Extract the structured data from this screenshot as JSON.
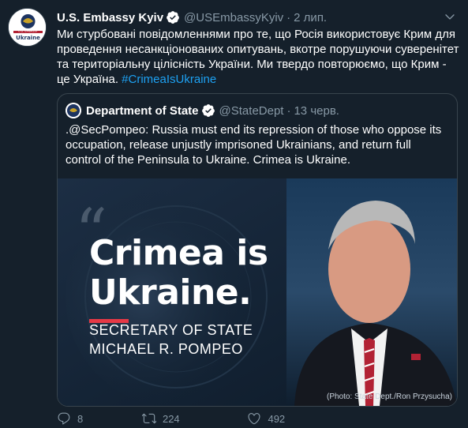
{
  "tweet": {
    "display_name": "U.S. Embassy Kyiv",
    "handle": "@USEmbassyKyiv",
    "separator": "·",
    "date": "2 лип.",
    "avatar_label_top": "U.S. EMBASSY",
    "avatar_label_bottom": "Ukraine",
    "text": "Ми стурбовані повідомленнями про те, що Росія використовує Крим для проведення несанкціонованих опитувань, вкотре порушуючи суверенітет та територіальну цілісність України. Ми твердо повторюємо, що Крим - це Україна. ",
    "hashtag": "#CrimeaIsUkraine"
  },
  "quoted": {
    "display_name": "Department of State",
    "handle": "@StateDept",
    "separator": "·",
    "date": "13 черв.",
    "text": ".@SecPompeo: Russia must end its repression of those who oppose its occupation, release unjustly imprisoned Ukrainians, and return full control of the Peninsula to Ukraine. Crimea is Ukraine.",
    "image": {
      "quote_mark": "“",
      "headline_line1": "Crimea is",
      "headline_line2": "Ukraine.",
      "title": "SECRETARY OF STATE",
      "name": "MICHAEL R. POMPEO",
      "credit": "(Photo: State Dept./Ron Przysucha)"
    }
  },
  "actions": {
    "replies": "8",
    "retweets": "224",
    "likes": "492"
  },
  "icons": {
    "verified": "verified-badge-icon",
    "more": "chevron-down-icon",
    "reply": "reply-icon",
    "retweet": "retweet-icon",
    "like": "heart-icon",
    "share": "share-icon"
  },
  "colors": {
    "background": "#15202b",
    "accent": "#1da1f2",
    "muted": "#8899a6",
    "border": "#38444d"
  }
}
